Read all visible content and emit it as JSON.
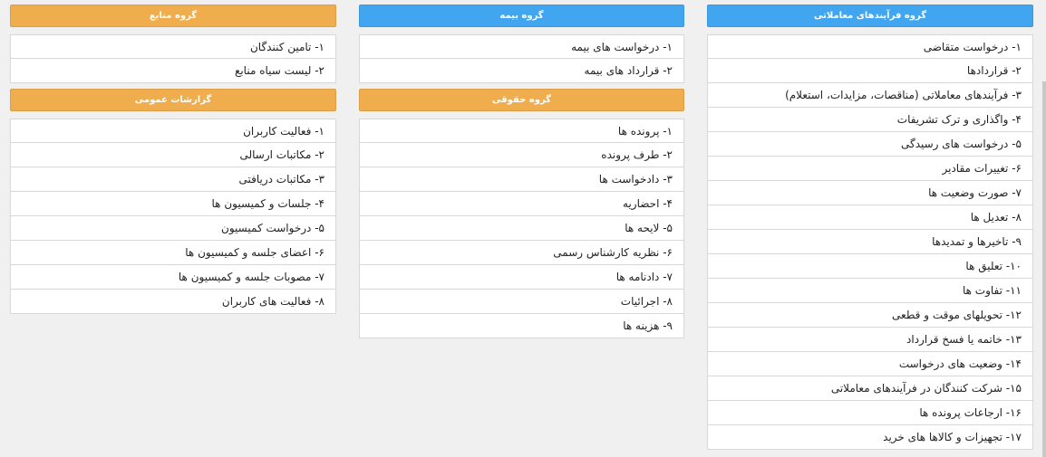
{
  "groups": {
    "transactions": {
      "title": "گروه فرآیندهای معاملاتی",
      "items": [
        "۱- درخواست متقاضی",
        "۲- قراردادها",
        "۳- فرآیندهای معاملاتی (مناقصات، مزایدات، استعلام)",
        "۴- واگذاری و ترک تشریفات",
        "۵- درخواست های رسیدگی",
        "۶- تغییرات مقادیر",
        "۷- صورت وضعیت ها",
        "۸- تعدیل ها",
        "۹- تاخیرها و تمدیدها",
        "۱۰- تعلیق ها",
        "۱۱- تفاوت ها",
        "۱۲- تحویلهای موقت و قطعی",
        "۱۳- خاتمه یا فسخ قرارداد",
        "۱۴- وضعیت های درخواست",
        "۱۵- شرکت کنندگان در فرآیندهای معاملاتی",
        "۱۶- ارجاعات پرونده ها",
        "۱۷- تجهیزات و کالاها های خرید"
      ]
    },
    "insurance": {
      "title": "گروه بیمه",
      "items": [
        "۱- درخواست های بیمه",
        "۲- قرارداد های بیمه"
      ]
    },
    "legal": {
      "title": "گروه حقوقی",
      "items": [
        "۱- پرونده ها",
        "۲- طرف پرونده",
        "۳- دادخواست ها",
        "۴- احضاریه",
        "۵- لایحه ها",
        "۶- نظریه کارشناس رسمی",
        "۷- دادنامه ها",
        "۸- اجرائیات",
        "۹- هزینه ها"
      ]
    },
    "resources": {
      "title": "گروه منابع",
      "items": [
        "۱- تامین کنندگان",
        "۲- لیست سیاه منابع"
      ]
    },
    "reports": {
      "title": "گزارشات عمومی",
      "items": [
        "۱- فعالیت کاربران",
        "۲- مکاتبات ارسالی",
        "۳- مکاتبات دریافتی",
        "۴- جلسات و کمیسیون ها",
        "۵- درخواست کمیسیون",
        "۶- اعضای جلسه و کمیسیون ها",
        "۷- مصوبات جلسه و کمیسیون ها",
        "۸- فعالیت های کاربران"
      ]
    }
  },
  "colors": {
    "blue_header": "#42a5f0",
    "orange_header": "#efad4e"
  }
}
